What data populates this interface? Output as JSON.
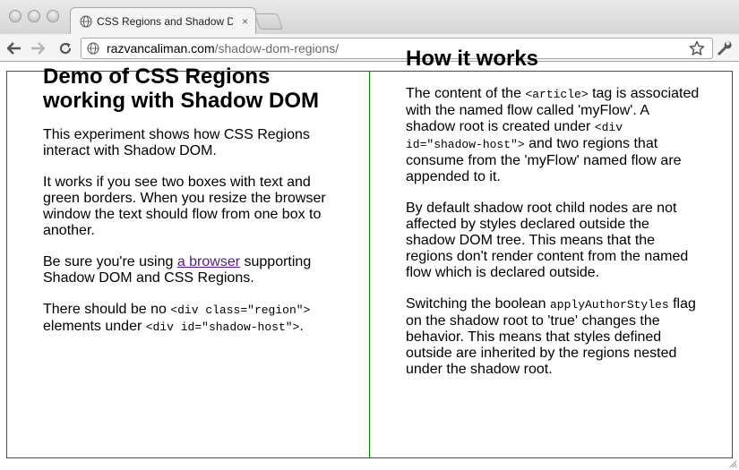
{
  "browser": {
    "tab_title": "CSS Regions and Shadow DOM",
    "tab_close": "×",
    "url_host": "razvancaliman.com",
    "url_path": "/shadow-dom-regions/"
  },
  "left": {
    "title": "Demo of CSS Regions working with Shadow DOM",
    "p1": "This experiment shows how CSS Regions interact with Shadow DOM.",
    "p2": "It works if you see two boxes with text and green borders. When you resize the browser window the text should flow from one box to another.",
    "p3_before": "Be sure you're using ",
    "p3_link": "a browser",
    "p3_after": " supporting Shadow DOM and CSS Regions.",
    "p4_before": "There should be no ",
    "p4_code1": "<div class=\"region\">",
    "p4_mid": " elements under ",
    "p4_code2": "<div id=\"shadow-host\">",
    "p4_after": "."
  },
  "right": {
    "title": "How it works",
    "p1_a": "The content of the ",
    "p1_code1": "<article>",
    "p1_b": " tag is associated with the named flow called 'myFlow'. A shadow root is created under ",
    "p1_code2": "<div id=\"shadow-host\">",
    "p1_c": " and two regions that consume from the 'myFlow' named flow are appended to it.",
    "p2": "By default shadow root child nodes are not affected by styles declared outside the shadow DOM tree. This means that the regions don't render content from the named flow which is declared outside.",
    "p3_a": "Switching the boolean ",
    "p3_code": "applyAuthorStyles",
    "p3_b": " flag on the shadow root to 'true' changes the behavior. This means that styles defined outside are inherited by the regions nested under the shadow root."
  },
  "colors": {
    "region_border": "#008000",
    "visited_link": "#551a8b"
  }
}
